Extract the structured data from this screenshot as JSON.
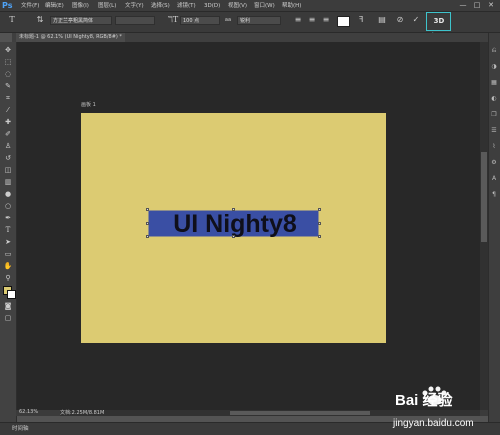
{
  "app": {
    "logo": "Ps"
  },
  "menu": [
    "文件(F)",
    "编辑(E)",
    "图像(I)",
    "图层(L)",
    "文字(Y)",
    "选择(S)",
    "滤镜(T)",
    "3D(D)",
    "视图(V)",
    "窗口(W)",
    "帮助(H)"
  ],
  "window_controls": {
    "minimize": "—",
    "maximize": "□",
    "close": "✕"
  },
  "options": {
    "tool_icon": "T",
    "font_family": "方正兰亭粗黑简体",
    "font_size": "100 点",
    "aa_icon": "aa",
    "antialias": "锐利",
    "threed_label": "3D"
  },
  "document": {
    "tab": "未标题-1 @ 62.1% (UI Nighty8, RGB/8#) *",
    "artboard_label": "画板 1",
    "text": "UI Nighty8"
  },
  "status": {
    "zoom": "62.13%",
    "doc_info": "文档:2.25M/8.81M"
  },
  "timeline": {
    "label": "时间轴"
  },
  "watermark": {
    "brand": "Bai 经验",
    "url": "jingyan.baidu.com"
  },
  "colors": {
    "accent": "#3ec3cb",
    "artboard": "#dccb72",
    "text_selection": "#3a4fa4"
  },
  "icons": {
    "tools": [
      "move-icon",
      "marquee-icon",
      "lasso-icon",
      "quick-select-icon",
      "crop-icon",
      "eyedropper-icon",
      "healing-icon",
      "brush-icon",
      "stamp-icon",
      "history-brush-icon",
      "eraser-icon",
      "gradient-icon",
      "blur-icon",
      "dodge-icon",
      "pen-icon",
      "type-icon",
      "path-select-icon",
      "rectangle-icon",
      "hand-icon",
      "zoom-icon"
    ],
    "right": [
      "history-icon",
      "color-icon",
      "swatches-icon",
      "adjust-icon",
      "layers-icon",
      "channels-icon",
      "paths-icon",
      "properties-icon",
      "character-icon",
      "paragraph-icon"
    ]
  }
}
